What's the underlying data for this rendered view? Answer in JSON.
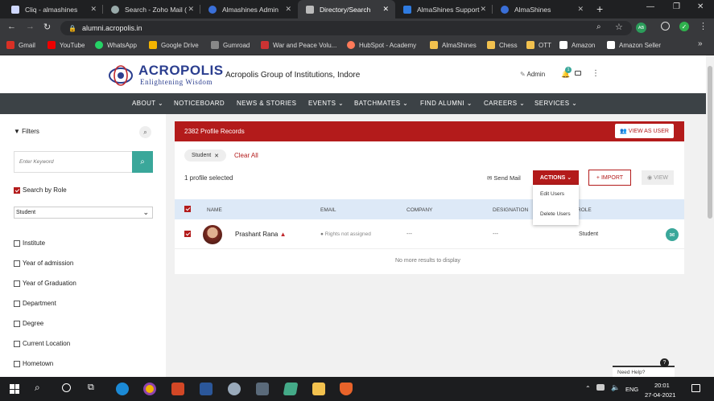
{
  "browser": {
    "tabs": [
      {
        "title": "Cliq - almashines",
        "color": "#cfd8ff"
      },
      {
        "title": "Search - Zoho Mail (",
        "color": "#9aa"
      },
      {
        "title": "Almashines Admin",
        "color": "#3a6fd8"
      },
      {
        "title": "Directory/Search",
        "color": "#bbb"
      },
      {
        "title": "AlmaShines Support",
        "color": "#2f7be0"
      },
      {
        "title": "AlmaShines",
        "color": "#3a6fd8"
      }
    ],
    "new_tab": "+",
    "url": "alumni.acropolis.in",
    "profile_initials": "AB",
    "bookmarks": [
      {
        "label": "Gmail",
        "color": "#d93025"
      },
      {
        "label": "YouTube",
        "color": "#e00"
      },
      {
        "label": "WhatsApp",
        "color": "#25d366"
      },
      {
        "label": "Google Drive",
        "color": "#f4b400"
      },
      {
        "label": "Gumroad",
        "color": "#888"
      },
      {
        "label": "War and Peace Volu...",
        "color": "#c33"
      },
      {
        "label": "HubSpot - Academy",
        "color": "#ff7a59"
      },
      {
        "label": "AlmaShines",
        "color": "#f2c14e"
      },
      {
        "label": "Chess",
        "color": "#f2c14e"
      },
      {
        "label": "OTT",
        "color": "#f2c14e"
      },
      {
        "label": "Amazon",
        "color": "#fff"
      },
      {
        "label": "Amazon Seller",
        "color": "#fff"
      }
    ],
    "more": "»"
  },
  "header": {
    "logo_title": "ACROPOLIS",
    "logo_tagline": "Enlightening Wisdom",
    "org_name": "Acropolis Group of Institutions, Indore",
    "admin_label": "Admin",
    "notif_count": "1"
  },
  "nav": {
    "items": [
      {
        "label": "ABOUT",
        "caret": true
      },
      {
        "label": "NOTICEBOARD",
        "caret": false
      },
      {
        "label": "NEWS & STORIES",
        "caret": false
      },
      {
        "label": "EVENTS",
        "caret": true
      },
      {
        "label": "BATCHMATES",
        "caret": true
      },
      {
        "label": "FIND ALUMNI",
        "caret": true
      },
      {
        "label": "CAREERS",
        "caret": true
      },
      {
        "label": "SERVICES",
        "caret": true
      }
    ]
  },
  "sidebar": {
    "filters_label": "Filters",
    "keyword_placeholder": "Enter Keyword",
    "search_by_role": "Search by Role",
    "role_selected": "Student",
    "filters": [
      "Institute",
      "Year of admission",
      "Year of Graduation",
      "Department",
      "Degree",
      "Current Location",
      "Hometown"
    ]
  },
  "results": {
    "header_title": "2382 Profile Records",
    "view_as_user": "VIEW AS USER",
    "chip": "Student",
    "clear_all": "Clear All",
    "selected_text": "1 profile selected",
    "send_mail": "Send Mail",
    "actions": "ACTIONS",
    "import": "IMPORT",
    "view": "VIEW",
    "dropdown": [
      "Edit Users",
      "Delete Users"
    ],
    "columns": {
      "name": "NAME",
      "email": "EMAIL",
      "company": "COMPANY",
      "designation": "DESIGNATION",
      "role": "ROLE"
    },
    "rows": [
      {
        "name": "Prashant Rana",
        "email": "Rights not assigned",
        "company": "---",
        "designation": "---",
        "role": "Student"
      }
    ],
    "no_more": "No more results to display"
  },
  "help": {
    "need_help": "Need Help?",
    "badge": "?"
  },
  "taskbar": {
    "lang": "ENG",
    "time": "20:01",
    "date": "27-04-2021"
  },
  "colors": {
    "brand_red": "#b31b1b",
    "nav_dark": "#3c4246",
    "teal": "#3aa79a",
    "accent_green": "#1e9e63"
  }
}
